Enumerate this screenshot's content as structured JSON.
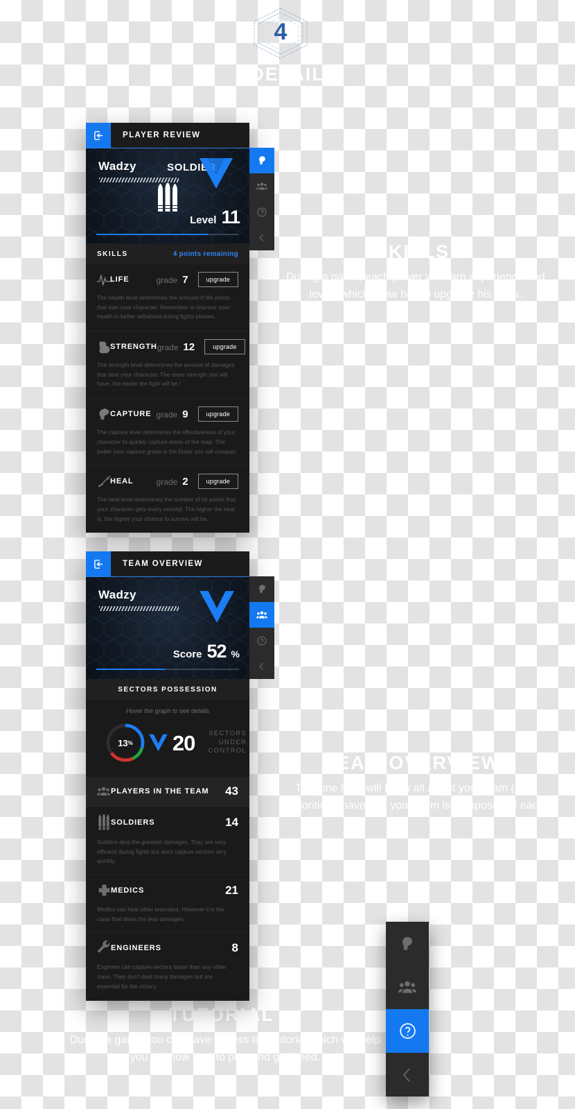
{
  "watermark": {
    "badge_number": "4",
    "badge_label": "DETAIL",
    "skills_title": "SKILLS",
    "skills_body": "During a game, each player will earn experience and levels which allow him to upgrade his skills.",
    "team_title": "TEAM OVERVIEW",
    "team_body": "This one here will know all about your team (their majorities), have and your team is composed of each.",
    "tutorial_title": "TUTORIAL",
    "tutorial_body": "During a game you can have access to a tutorial which will help you to know how to play and get freed."
  },
  "player_panel": {
    "titlebar": {
      "back_icon": "exit-icon",
      "title": "PLAYER REVIEW"
    },
    "hero": {
      "player_name": "Wadzy",
      "class_label": "SOLDIER",
      "class_icon": "bullets-icon",
      "stat_word": "Level",
      "stat_value": "11",
      "progress_percent": 78
    },
    "sidenav": [
      {
        "name": "sidebar-item-player",
        "icon": "player-head-icon",
        "active": true
      },
      {
        "name": "sidebar-item-team",
        "icon": "team-group-icon",
        "active": false
      },
      {
        "name": "sidebar-item-help",
        "icon": "question-circle-icon",
        "active": false
      },
      {
        "name": "sidebar-item-collapse",
        "icon": "chevron-left-icon",
        "active": false
      }
    ],
    "section": {
      "label": "SKILLS",
      "points": "4 points remaining"
    },
    "skills": [
      {
        "icon": "heartbeat-icon",
        "name": "LIFE",
        "grade_label": "grade",
        "grade": "7",
        "button": "upgrade",
        "desc": "The health level determines the amount of life points that own your character. Remember to improve your health to better withstand during fights phases."
      },
      {
        "icon": "biceps-icon",
        "name": "STRENGTH",
        "grade_label": "grade",
        "grade": "12",
        "button": "upgrade",
        "desc": "The strength level determines the amount of damages that deal your character. The more strength you will have, the easier the fight will be !"
      },
      {
        "icon": "flag-head-icon",
        "name": "CAPTURE",
        "grade_label": "grade",
        "grade": "9",
        "button": "upgrade",
        "desc": "The capture level determines the effectiveness of your character to quickly capture areas of the map. The better your capture grade is the faster you will conquer."
      },
      {
        "icon": "syringe-icon",
        "name": "HEAL",
        "grade_label": "grade",
        "grade": "2",
        "button": "upgrade",
        "desc": "The heal level determines the number of hit points that your character gets every second. The higher the heal is, the higher your chance to survive will be."
      }
    ]
  },
  "team_panel": {
    "titlebar": {
      "back_icon": "exit-icon",
      "title": "TEAM OVERVIEW"
    },
    "hero": {
      "player_name": "Wadzy",
      "stat_word": "Score",
      "stat_value": "52",
      "stat_suffix": "%",
      "progress_percent": 48
    },
    "sidenav": [
      {
        "name": "sidebar-item-player",
        "icon": "player-head-icon",
        "active": false
      },
      {
        "name": "sidebar-item-team",
        "icon": "team-group-icon",
        "active": true
      },
      {
        "name": "sidebar-item-help",
        "icon": "question-circle-icon",
        "active": false
      },
      {
        "name": "sidebar-item-collapse",
        "icon": "chevron-left-icon",
        "active": false
      }
    ],
    "section": {
      "label": "SECTORS POSSESSION"
    },
    "hint": "Hover the graph to see details",
    "donut": {
      "center_value": "13",
      "center_suffix": "%",
      "segments": [
        {
          "name": "blue",
          "color": "#1b7ef5",
          "percent": 30
        },
        {
          "name": "green",
          "color": "#21a341",
          "percent": 13
        },
        {
          "name": "red",
          "color": "#d1332e",
          "percent": 22
        },
        {
          "name": "empty",
          "color": "#2e2e2e",
          "percent": 35
        }
      ]
    },
    "sectors": {
      "icon": "v-chevron-icon",
      "value": "20",
      "line1": "SECTORS",
      "line2": "UNDER CONTROL"
    },
    "roster_header": {
      "icon": "team-group-icon",
      "label": "PLAYERS IN THE TEAM",
      "value": "43"
    },
    "classes": [
      {
        "icon": "bullets-icon",
        "name": "SOLDIERS",
        "value": "14",
        "desc": "Soldiers deal the greatest damages. They are very efficient during fights but don't capture sectors very quickly."
      },
      {
        "icon": "medkit-cross-icon",
        "name": "MEDICS",
        "value": "21",
        "desc": "Medics can heal other teamates. However it is the class that deals the less damages."
      },
      {
        "icon": "wrench-icon",
        "name": "ENGINEERS",
        "value": "8",
        "desc": "Engineer can capture sectors faster than any other class. They don't deal many damages but are essential for the victory."
      }
    ]
  },
  "float_nav": [
    {
      "name": "sidebar-item-player",
      "icon": "player-head-icon",
      "active": false
    },
    {
      "name": "sidebar-item-team",
      "icon": "team-group-icon",
      "active": false
    },
    {
      "name": "sidebar-item-help",
      "icon": "question-circle-icon",
      "active": true
    },
    {
      "name": "sidebar-item-collapse",
      "icon": "chevron-left-icon",
      "active": false
    }
  ],
  "colors": {
    "accent": "#1479f0",
    "panel_dark": "#1a1a1a",
    "hero_dark": "#121a26"
  }
}
